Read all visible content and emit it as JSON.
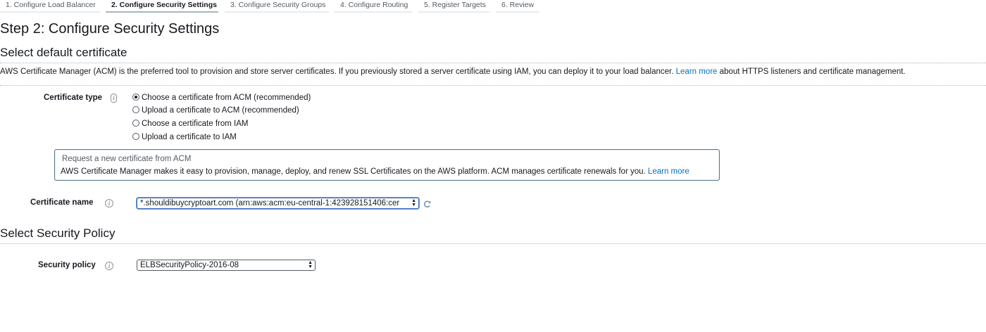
{
  "wizard": {
    "steps": [
      {
        "label": "1. Configure Load Balancer",
        "active": false
      },
      {
        "label": "2. Configure Security Settings",
        "active": true
      },
      {
        "label": "3. Configure Security Groups",
        "active": false
      },
      {
        "label": "4. Configure Routing",
        "active": false
      },
      {
        "label": "5. Register Targets",
        "active": false
      },
      {
        "label": "6. Review",
        "active": false
      }
    ]
  },
  "page": {
    "title": "Step 2: Configure Security Settings"
  },
  "default_certificate": {
    "heading": "Select default certificate",
    "intro": "AWS Certificate Manager (ACM) is the preferred tool to provision and store server certificates. If you previously stored a server certificate using IAM, you can deploy it to your load balancer.",
    "learn_more": "Learn more",
    "intro_suffix": "about HTTPS listeners and certificate management.",
    "certificate_type": {
      "label": "Certificate type",
      "info_icon": "info-icon",
      "options": [
        {
          "label": "Choose a certificate from ACM (recommended)",
          "checked": true
        },
        {
          "label": "Upload a certificate to ACM (recommended)",
          "checked": false
        },
        {
          "label": "Choose a certificate from IAM",
          "checked": false
        },
        {
          "label": "Upload a certificate to IAM",
          "checked": false
        }
      ]
    },
    "acm_box": {
      "title": "Request a new certificate from ACM",
      "text": "AWS Certificate Manager makes it easy to provision, manage, deploy, and renew SSL Certificates on the AWS platform. ACM manages certificate renewals for you.",
      "learn_more": "Learn more"
    },
    "certificate_name": {
      "label": "Certificate name",
      "info_icon": "info-icon",
      "selected": "*.shouldibuycryptoart.com (arn:aws:acm:eu-central-1:423928151406:cer",
      "refresh_icon": "refresh-icon"
    }
  },
  "security_policy": {
    "heading": "Select Security Policy",
    "label": "Security policy",
    "info_icon": "info-icon",
    "selected": "ELBSecurityPolicy-2016-08"
  },
  "colors": {
    "link": "#0073bb",
    "text": "#16191f",
    "box_border": "#5a7a8c",
    "focus": "#6a9bd8"
  }
}
